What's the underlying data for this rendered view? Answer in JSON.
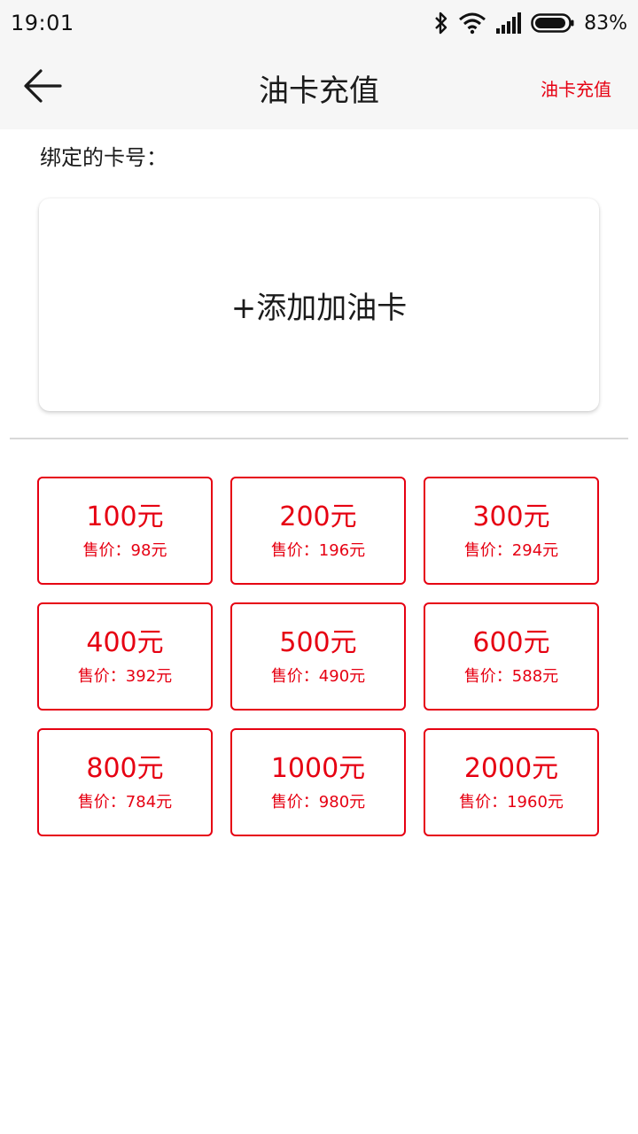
{
  "status": {
    "time": "19:01",
    "battery": "83%",
    "icons": [
      "bluetooth-icon",
      "wifi-icon",
      "signal-icon",
      "battery-icon"
    ]
  },
  "header": {
    "back_icon": "arrow-left-icon",
    "title": "油卡充值",
    "action": "油卡充值"
  },
  "card": {
    "bound_label": "绑定的卡号：",
    "add_label": "+添加加油卡"
  },
  "colors": {
    "accent": "#e60012",
    "text": "#1b1b1b",
    "bar": "#f6f6f6"
  },
  "denominations": [
    {
      "face": "100元",
      "price": "售价：98元"
    },
    {
      "face": "200元",
      "price": "售价：196元"
    },
    {
      "face": "300元",
      "price": "售价：294元"
    },
    {
      "face": "400元",
      "price": "售价：392元"
    },
    {
      "face": "500元",
      "price": "售价：490元"
    },
    {
      "face": "600元",
      "price": "售价：588元"
    },
    {
      "face": "800元",
      "price": "售价：784元"
    },
    {
      "face": "1000元",
      "price": "售价：980元"
    },
    {
      "face": "2000元",
      "price": "售价：1960元"
    }
  ]
}
